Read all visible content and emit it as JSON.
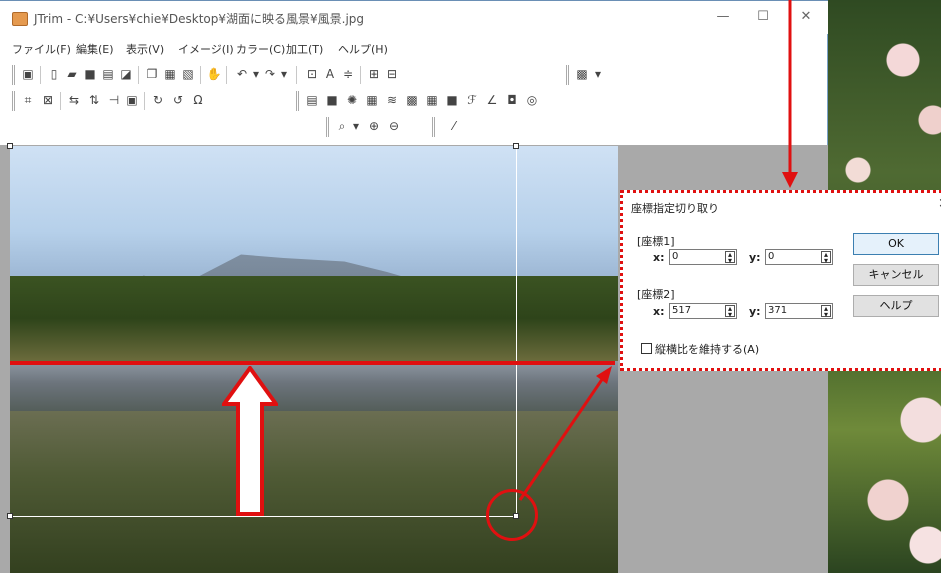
{
  "window": {
    "title": "JTrim - C:¥Users¥chie¥Desktop¥湖面に映る風景¥風景.jpg",
    "minimize": "—",
    "maximize": "☐",
    "close": "✕"
  },
  "menu": [
    "ファイル(F)",
    "編集(E)",
    "表示(V)",
    "イメージ(I)",
    "カラー(C)",
    "加工(T)",
    "ヘルプ(H)"
  ],
  "dialog": {
    "title": "座標指定切り取り",
    "close": "×",
    "coord1_label": "[座標1]",
    "coord2_label": "[座標2]",
    "x_label": "x:",
    "y_label": "y:",
    "coord1": {
      "x": "0",
      "y": "0"
    },
    "coord2": {
      "x": "517",
      "y": "371"
    },
    "ok_label": "OK",
    "cancel_label": "キャンセル",
    "help_label": "ヘルプ",
    "aspect_label": "縦横比を維持する(A)",
    "aspect_checked": false
  },
  "colors": {
    "annotation": "#e01010",
    "accent": "#3c7fb1"
  }
}
